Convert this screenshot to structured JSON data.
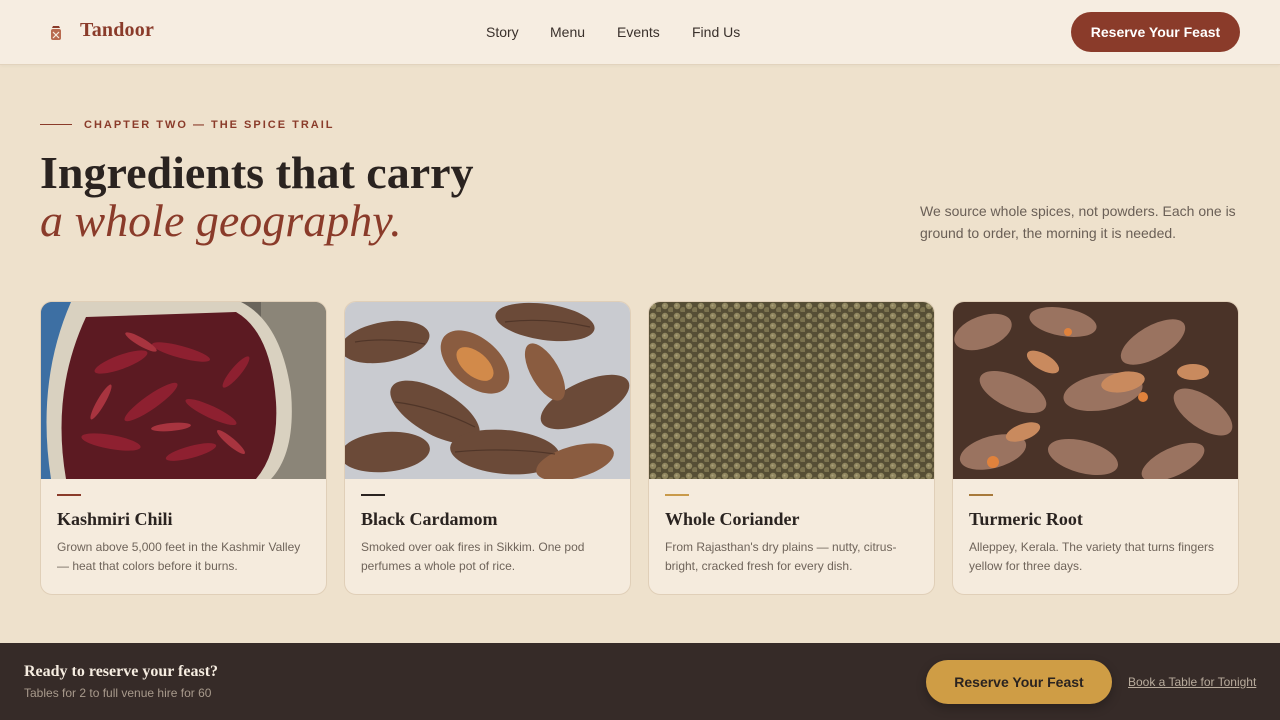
{
  "header": {
    "brand": "Tandoor",
    "nav": [
      "Story",
      "Menu",
      "Events",
      "Find Us"
    ],
    "cta": "Reserve Your Feast",
    "logo_icon": "spice-jar-icon"
  },
  "hero": {
    "eyebrow": "CHAPTER TWO — THE SPICE TRAIL",
    "title_line1": "Ingredients that carry",
    "title_line2": "a whole geography.",
    "intro": "We source whole spices, not powders. Each one is ground to order, the morning it is needed."
  },
  "cards": [
    {
      "title": "Kashmiri Chili",
      "desc": "Grown above 5,000 feet in the Kashmir Valley — heat that colors before it burns.",
      "accent": "#8a3b2a"
    },
    {
      "title": "Black Cardamom",
      "desc": "Smoked over oak fires in Sikkim. One pod perfumes a whole pot of rice.",
      "accent": "#2a2320"
    },
    {
      "title": "Whole Coriander",
      "desc": "From Rajasthan's dry plains — nutty, citrus-bright, cracked fresh for every dish.",
      "accent": "#c99a4a"
    },
    {
      "title": "Turmeric Root",
      "desc": "Alleppey, Kerala. The variety that turns fingers yellow for three days.",
      "accent": "#a7793a"
    }
  ],
  "footer": {
    "title": "Ready to reserve your feast?",
    "subtitle": "Tables for 2 to full venue hire for 60",
    "cta": "Reserve Your Feast",
    "link": "Book a Table for Tonight"
  },
  "colors": {
    "brand": "#8a3b2a",
    "gold": "#cf9d45",
    "background": "#eee1cc",
    "footer_bg": "#362b28"
  }
}
